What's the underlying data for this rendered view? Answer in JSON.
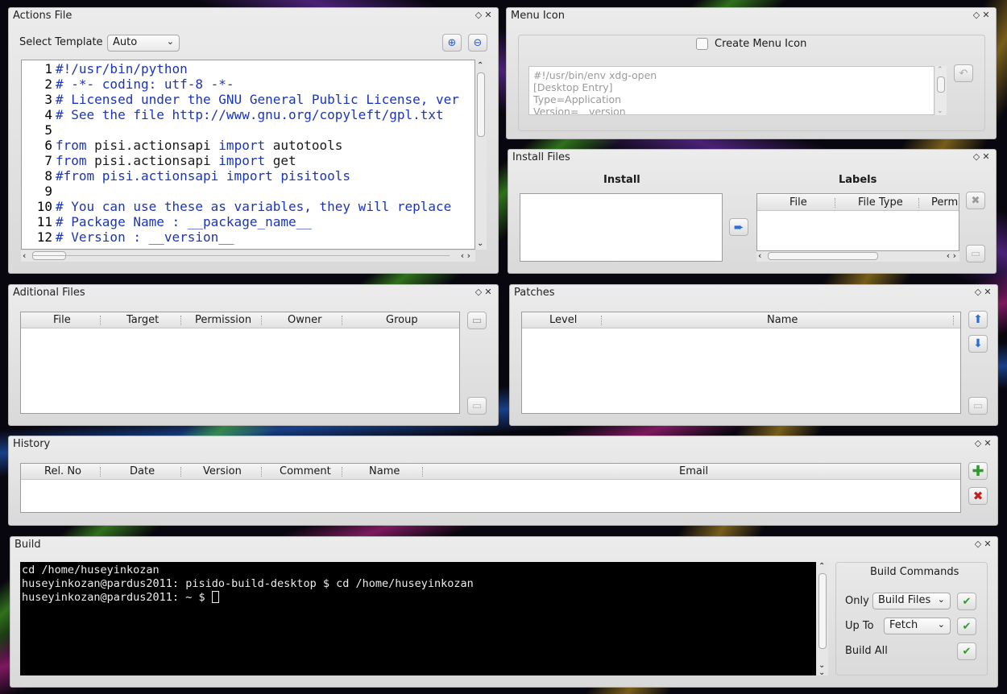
{
  "actions": {
    "title": "Actions File",
    "template_label": "Select Template",
    "template_value": "Auto",
    "line_numbers": [
      "1",
      "2",
      "3",
      "4",
      "5",
      "6",
      "7",
      "8",
      "9",
      "10",
      "11",
      "12"
    ],
    "code_lines": [
      {
        "a": "#!/usr/bin/python",
        "b": "",
        "cls": "cm"
      },
      {
        "a": "# -*- coding: utf-8 -*-",
        "b": "",
        "cls": "cm"
      },
      {
        "a": "# Licensed under the GNU General Public License, ver",
        "b": "",
        "cls": "cm"
      },
      {
        "a": "# See the file http://www.gnu.org/copyleft/gpl.txt",
        "b": "",
        "cls": "cm"
      },
      {
        "a": "",
        "b": "",
        "cls": ""
      },
      {
        "a": "from",
        "b": " pisi.actionsapi import autotools",
        "cls": "kw"
      },
      {
        "a": "from",
        "b": " pisi.actionsapi import get",
        "cls": "kw"
      },
      {
        "a": "#from pisi.actionsapi import pisitools",
        "b": "",
        "cls": "cm"
      },
      {
        "a": "",
        "b": "",
        "cls": ""
      },
      {
        "a": "# You can use these as variables, they will replace",
        "b": "",
        "cls": "cm"
      },
      {
        "a": "# Package Name : __package_name__",
        "b": "",
        "cls": "cm"
      },
      {
        "a": "# Version : __version__",
        "b": "",
        "cls": "cm"
      }
    ]
  },
  "menu_icon": {
    "title": "Menu Icon",
    "checkbox_label": "Create Menu Icon",
    "desktop_lines": [
      "#!/usr/bin/env xdg-open",
      "[Desktop Entry]",
      "Type=Application",
      "Version=__version"
    ]
  },
  "install_files": {
    "title": "Install Files",
    "install_label": "Install",
    "labels_label": "Labels",
    "columns": [
      "File",
      "File Type",
      "Perm"
    ]
  },
  "additional_files": {
    "title": "Aditional Files",
    "columns": [
      "File",
      "Target",
      "Permission",
      "Owner",
      "Group"
    ]
  },
  "patches": {
    "title": "Patches",
    "columns": [
      "Level",
      "Name"
    ]
  },
  "history": {
    "title": "History",
    "columns": [
      "Rel. No",
      "Date",
      "Version",
      "Comment",
      "Name",
      "Email"
    ]
  },
  "build": {
    "title": "Build",
    "terminal_lines": [
      "cd /home/huseyinkozan",
      "huseyinkozan@pardus2011: pisido-build-desktop $ cd /home/huseyinkozan",
      "huseyinkozan@pardus2011: ~ $ "
    ],
    "commands_title": "Build Commands",
    "only_label": "Only",
    "only_value": "Build Files",
    "upto_label": "Up To",
    "upto_value": "Fetch",
    "buildall_label": "Build All"
  },
  "icons": {
    "dock_float": "float-icon",
    "dock_close": "close-icon",
    "zoom_in": "zoom-in-icon",
    "zoom_out": "zoom-out-icon",
    "arrow_right": "arrow-right-icon",
    "arrow_up": "arrow-up-icon",
    "arrow_down": "arrow-down-icon",
    "add": "add-icon",
    "remove": "remove-icon",
    "run": "run-icon"
  },
  "colors": {
    "code_keyword": "#1b35b8",
    "terminal_bg": "#000000",
    "add_green": "#2e9a2e",
    "remove_red": "#c02020"
  }
}
